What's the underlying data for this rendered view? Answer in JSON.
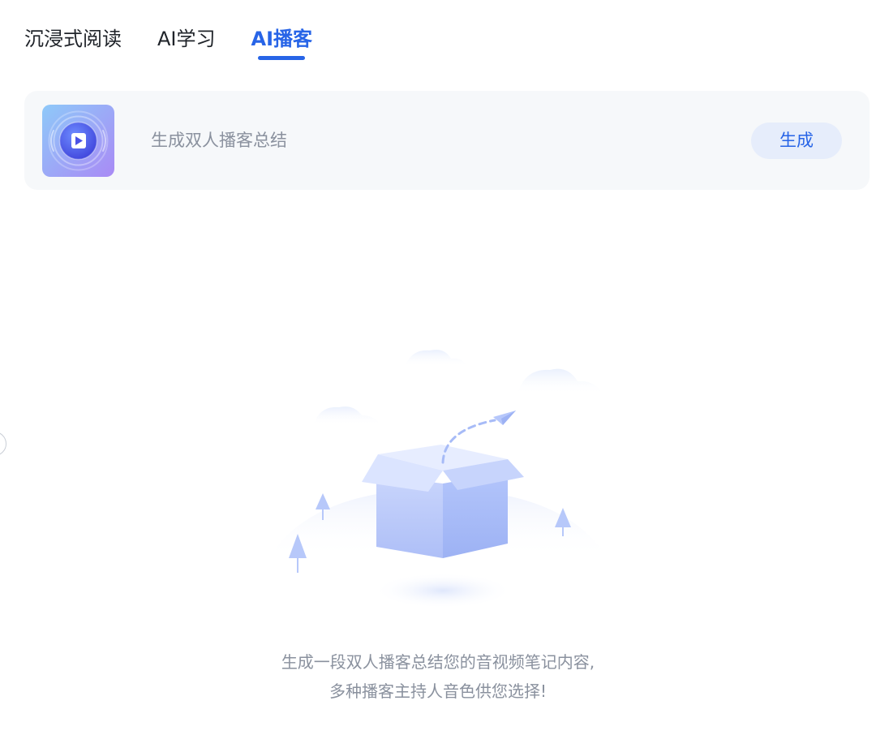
{
  "tabs": [
    {
      "label": "沉浸式阅读",
      "active": false
    },
    {
      "label": "AI学习",
      "active": false
    },
    {
      "label": "AI播客",
      "active": true
    }
  ],
  "podcast_card": {
    "icon": "play-icon",
    "title": "生成双人播客总结",
    "button_label": "生成"
  },
  "empty_state": {
    "illustration": "empty-box-illustration",
    "line1": "生成一段双人播客总结您的音视频笔记内容,",
    "line2": "多种播客主持人音色供您选择!"
  },
  "colors": {
    "accent": "#2764e7",
    "muted_text": "#8a919e",
    "card_bg": "#f6f8fa",
    "button_bg": "#e6edfb"
  }
}
